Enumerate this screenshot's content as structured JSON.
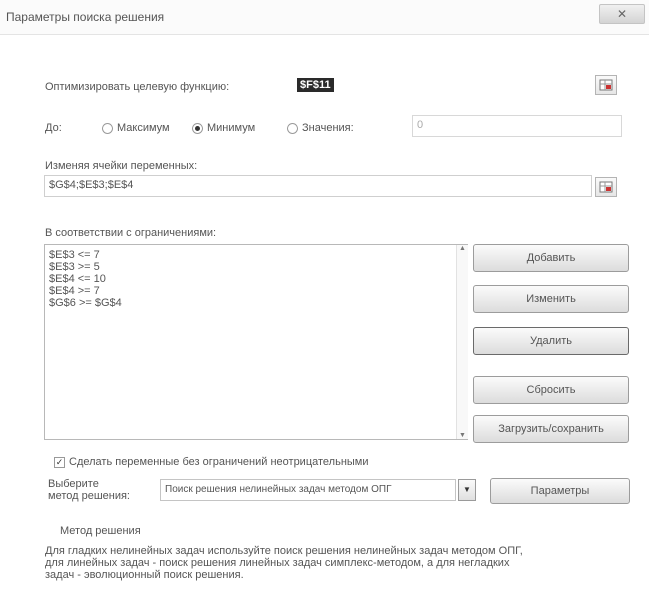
{
  "window": {
    "title": "Параметры поиска решения",
    "close_label": "✕"
  },
  "objective": {
    "label": "Оптимизировать целевую функцию:",
    "value": "$F$11",
    "ref_icon": "range-select-icon"
  },
  "to": {
    "label": "До:",
    "options": [
      "Максимум",
      "Минимум",
      "Значения:"
    ],
    "selected": "Минимум",
    "value": "0"
  },
  "variables": {
    "label": "Изменяя ячейки переменных:",
    "value": "$G$4;$E$3;$E$4"
  },
  "constraints": {
    "label": "В соответствии с ограничениями:",
    "items": [
      "$E$3 <= 7",
      "$E$3 >= 5",
      "$E$4 <= 10",
      "$E$4 >= 7",
      "$G$6 >= $G$4"
    ]
  },
  "buttons": {
    "add": "Добавить",
    "change": "Изменить",
    "delete": "Удалить",
    "reset": "Сбросить",
    "load_save": "Загрузить/сохранить",
    "params": "Параметры"
  },
  "nonneg": {
    "label": "Сделать переменные без ограничений неотрицательными",
    "checked": true
  },
  "method": {
    "label_line1": "Выберите",
    "label_line2": "метод решения:",
    "selected": "Поиск решения нелинейных задач методом ОПГ"
  },
  "method_desc": {
    "title": "Метод решения",
    "text_line1": "Для гладких нелинейных задач используйте поиск решения нелинейных задач методом ОПГ,",
    "text_line2": "для линейных задач - поиск решения линейных задач симплекс-методом, а для негладких",
    "text_line3": "задач - эволюционный поиск решения."
  },
  "colors": {
    "background": "#ffffff",
    "text": "#4a4a4a",
    "selection": "#2a2a2a"
  }
}
